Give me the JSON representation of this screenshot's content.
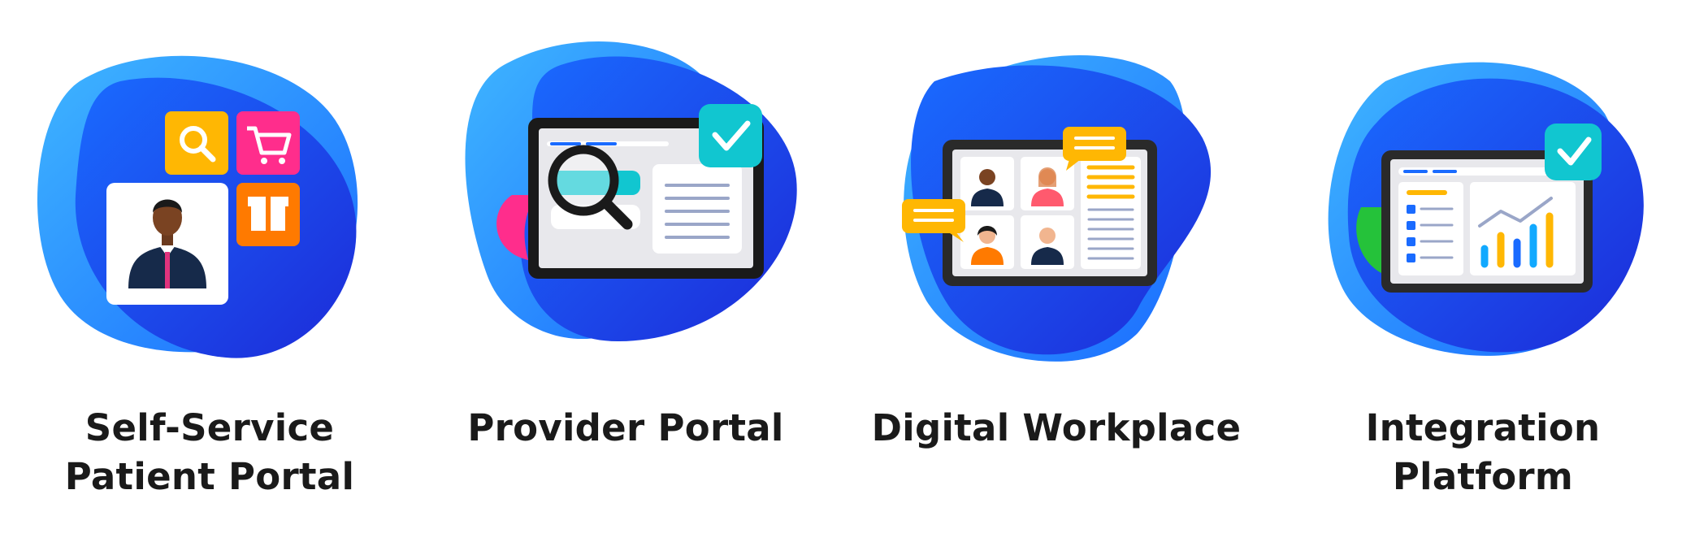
{
  "cards": [
    {
      "title_line1": "Self-Service",
      "title_line2": "Patient Portal",
      "illustration": "user-profile-with-search-cart-box-icons"
    },
    {
      "title_line1": "Provider Portal",
      "title_line2": "",
      "illustration": "tablet-with-magnifier-and-check"
    },
    {
      "title_line1": "Digital Workplace",
      "title_line2": "",
      "illustration": "tablet-with-video-call-grid-and-chat-bubbles"
    },
    {
      "title_line1": "Integration",
      "title_line2": "Platform",
      "illustration": "tablet-with-checklist-and-bar-chart-and-check"
    }
  ],
  "colors": {
    "blob_dark": "#1d2bd8",
    "blob_mid": "#1a6bff",
    "blob_light": "#3fb6ff",
    "accent_yellow": "#ffb703",
    "accent_pink": "#ff2d8c",
    "accent_orange": "#ff7a00",
    "accent_teal": "#11c6d0",
    "accent_green": "#25c23a",
    "text": "#1a1a1a"
  }
}
